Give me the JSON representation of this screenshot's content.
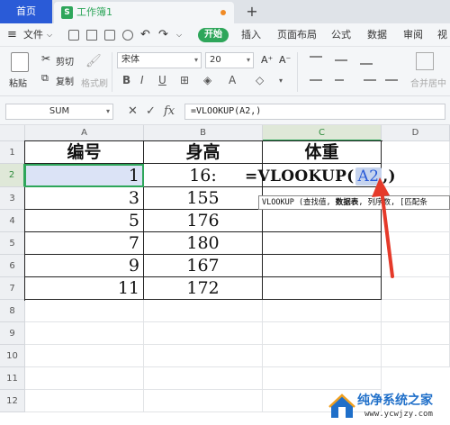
{
  "tabs": {
    "home": "首页",
    "document": "工作簿1",
    "doc_icon": "S",
    "add": "+"
  },
  "menu": {
    "file": "文件",
    "start": "开始",
    "insert": "插入",
    "page_layout": "页面布局",
    "formula": "公式",
    "data": "数据",
    "review": "审阅",
    "view": "视"
  },
  "ribbon": {
    "paste": "粘贴",
    "cut": "剪切",
    "copy": "复制",
    "format_painter": "格式刷",
    "font": "宋体",
    "font_size": "20",
    "bold": "B",
    "italic": "I",
    "underline": "U",
    "merge_center": "合并居中"
  },
  "formula_bar": {
    "name_box": "SUM",
    "cancel": "✕",
    "confirm": "✓",
    "fx": "fx",
    "formula": "=VLOOKUP(A2,)"
  },
  "columns": [
    "A",
    "B",
    "C",
    "D"
  ],
  "rows": [
    "1",
    "2",
    "3",
    "4",
    "5",
    "6",
    "7",
    "8",
    "9",
    "10",
    "11",
    "12"
  ],
  "table": {
    "headers": [
      "编号",
      "身高",
      "体重"
    ],
    "ids": [
      "1",
      "3",
      "5",
      "7",
      "9",
      "11"
    ],
    "heights": [
      "16:",
      "155",
      "176",
      "180",
      "167",
      "172"
    ]
  },
  "editing": {
    "prefix": "=VLOOKUP(",
    "ref": "A2",
    "suffix": ",)",
    "tooltip_pre": "VLOOKUP (查找值, ",
    "tooltip_bold": "数据表",
    "tooltip_post": ", 列序数, [匹配条"
  },
  "watermark": {
    "title": "纯净系统之家",
    "url": "www.ycwjzy.com"
  },
  "colors": {
    "accent": "#2ea65a",
    "home_tab": "#2a5bd7",
    "selection": "#dbe3f6",
    "arrow": "#e53a2a"
  }
}
